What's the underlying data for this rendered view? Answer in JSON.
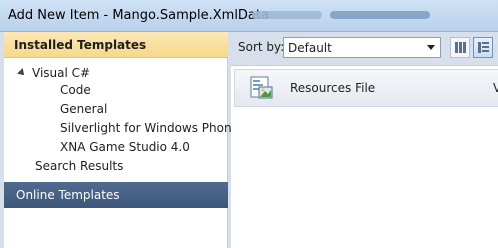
{
  "window": {
    "title": "Add New Item - Mango.Sample.XmlData"
  },
  "left_pane": {
    "installed_header": "Installed Templates",
    "tree": [
      {
        "label": "Visual C#"
      },
      {
        "label": "Code"
      },
      {
        "label": "General"
      },
      {
        "label": "Silverlight for Windows Phone"
      },
      {
        "label": "XNA Game Studio 4.0"
      },
      {
        "label": "Search Results"
      }
    ],
    "online_header": "Online Templates"
  },
  "toolbar": {
    "sort_label": "Sort by:",
    "sort_value": "Default"
  },
  "items": [
    {
      "label": "Resources File",
      "extra": "V"
    }
  ],
  "colors": {
    "installed_header": "#f7d98a",
    "online_header": "#3d5779",
    "titlebar": "#b9d1ec"
  }
}
